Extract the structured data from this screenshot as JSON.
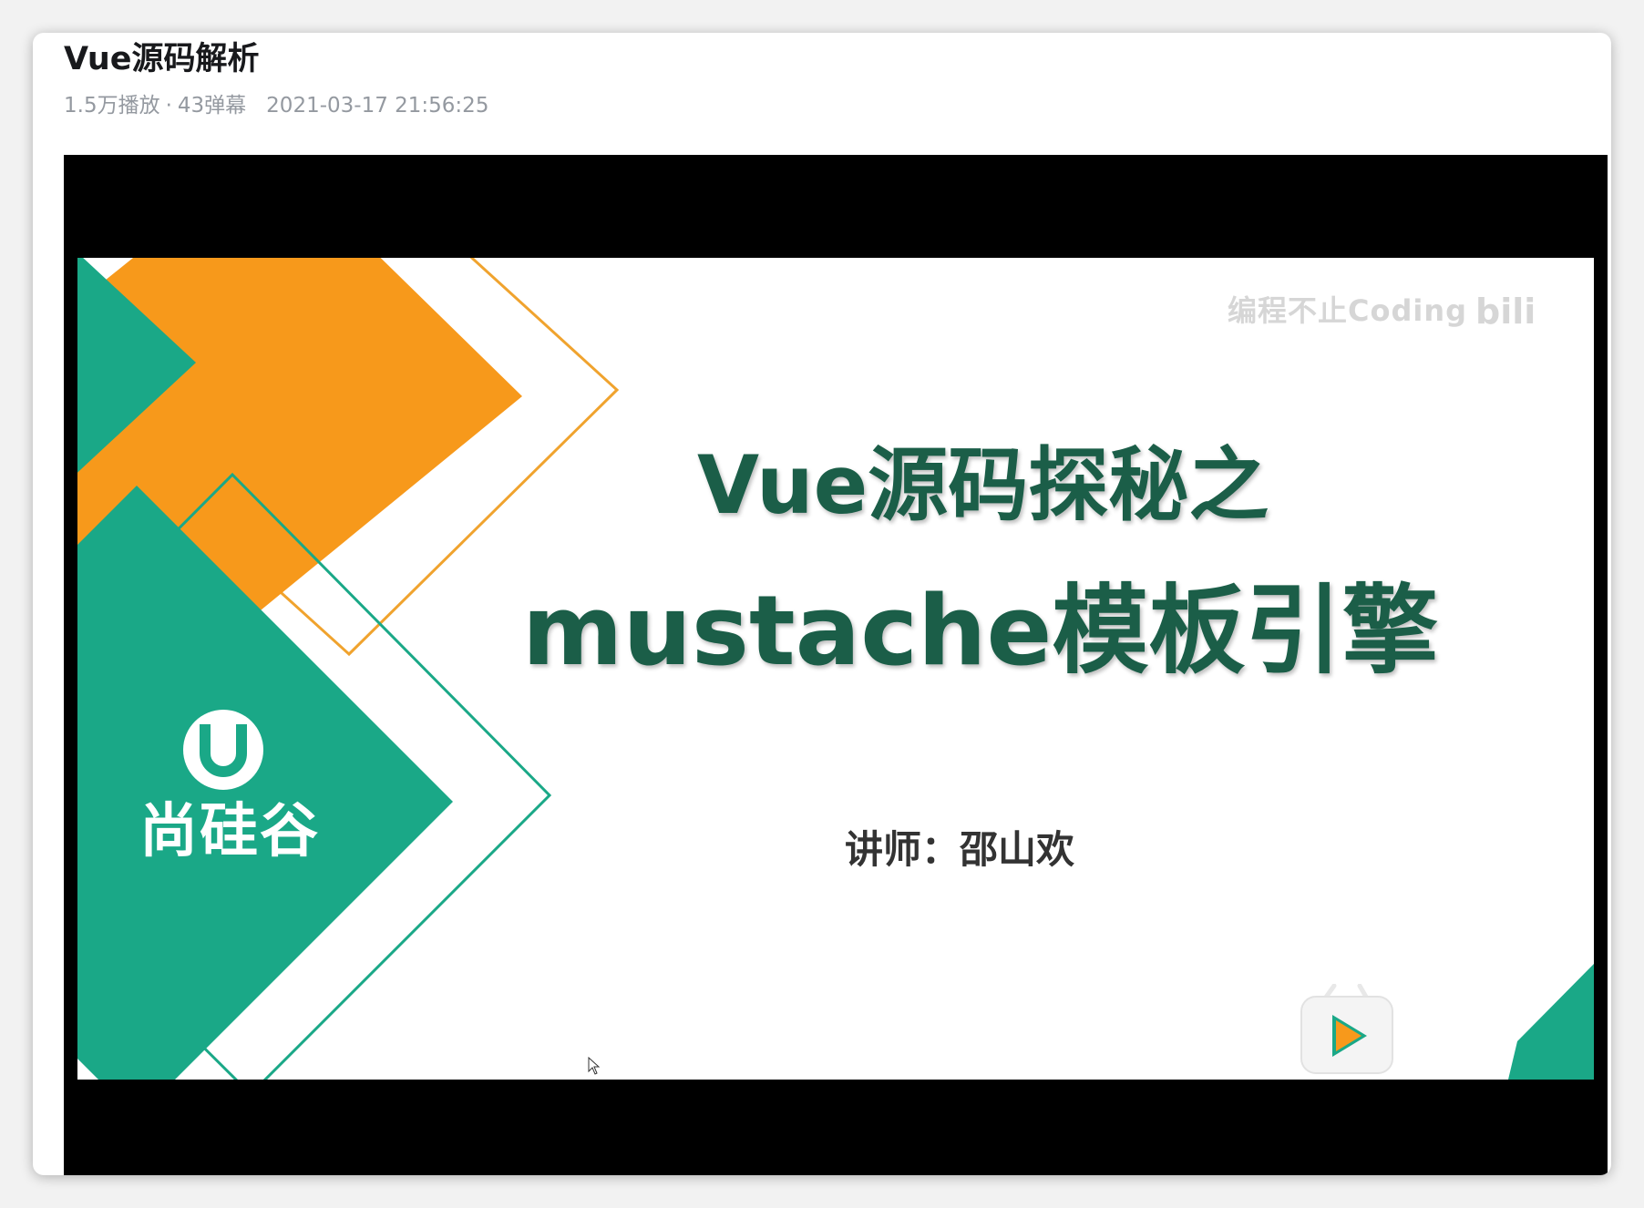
{
  "video": {
    "title": "Vue源码解析",
    "plays": "1.5万播放",
    "separator": "·",
    "danmaku": "43弹幕",
    "published": "2021-03-17 21:56:25"
  },
  "slide": {
    "heading_line1": "Vue源码探秘之",
    "heading_line2": "mustache模板引擎",
    "lecturer": "讲师：邵山欢",
    "brand_name": "尚硅谷",
    "watermark_text": "编程不止Coding"
  },
  "colors": {
    "orange": "#f7991b",
    "green": "#1aa887",
    "heading": "#1b5e48"
  },
  "icons": {
    "brand_logo": "u-logo-icon",
    "watermark_logo": "bilibili-logo-icon",
    "play_badge": "bilibili-tv-play-icon",
    "cursor": "mouse-cursor-icon"
  }
}
